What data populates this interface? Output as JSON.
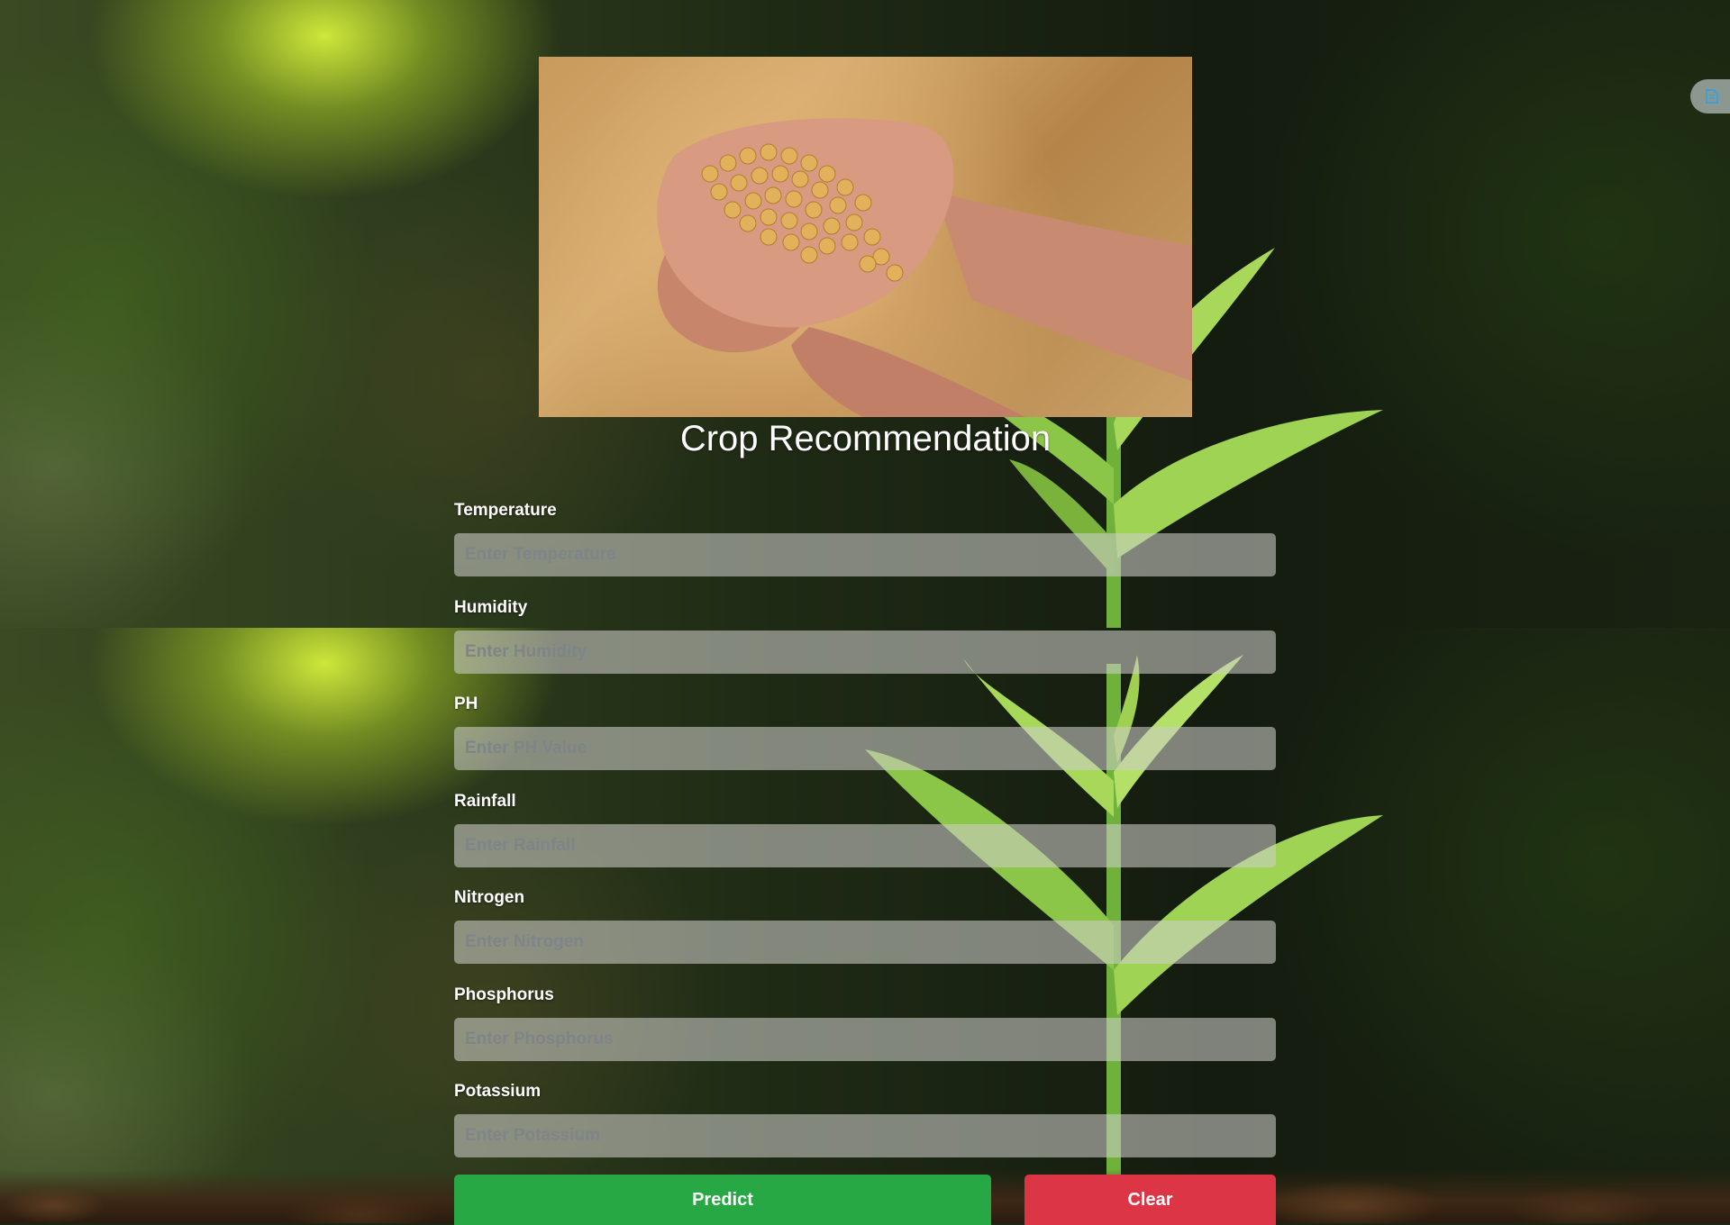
{
  "page": {
    "title": "Crop Recommendation"
  },
  "hero_image": {
    "description_icon": "hands-holding-seeds-image"
  },
  "form": {
    "fields": [
      {
        "label": "Temperature",
        "placeholder": "Enter Temperature"
      },
      {
        "label": "Humidity",
        "placeholder": "Enter Humidity"
      },
      {
        "label": "PH",
        "placeholder": "Enter PH Value"
      },
      {
        "label": "Rainfall",
        "placeholder": "Enter Rainfall"
      },
      {
        "label": "Nitrogen",
        "placeholder": "Enter Nitrogen"
      },
      {
        "label": "Phosphorus",
        "placeholder": "Enter Phosphorus"
      },
      {
        "label": "Potassium",
        "placeholder": "Enter Potassium"
      }
    ],
    "predict_label": "Predict",
    "clear_label": "Clear"
  },
  "colors": {
    "predict": "#28a745",
    "clear": "#dc3545",
    "input_bg": "rgba(205,205,200,0.58)"
  },
  "extension": {
    "icon": "extension-icon"
  }
}
